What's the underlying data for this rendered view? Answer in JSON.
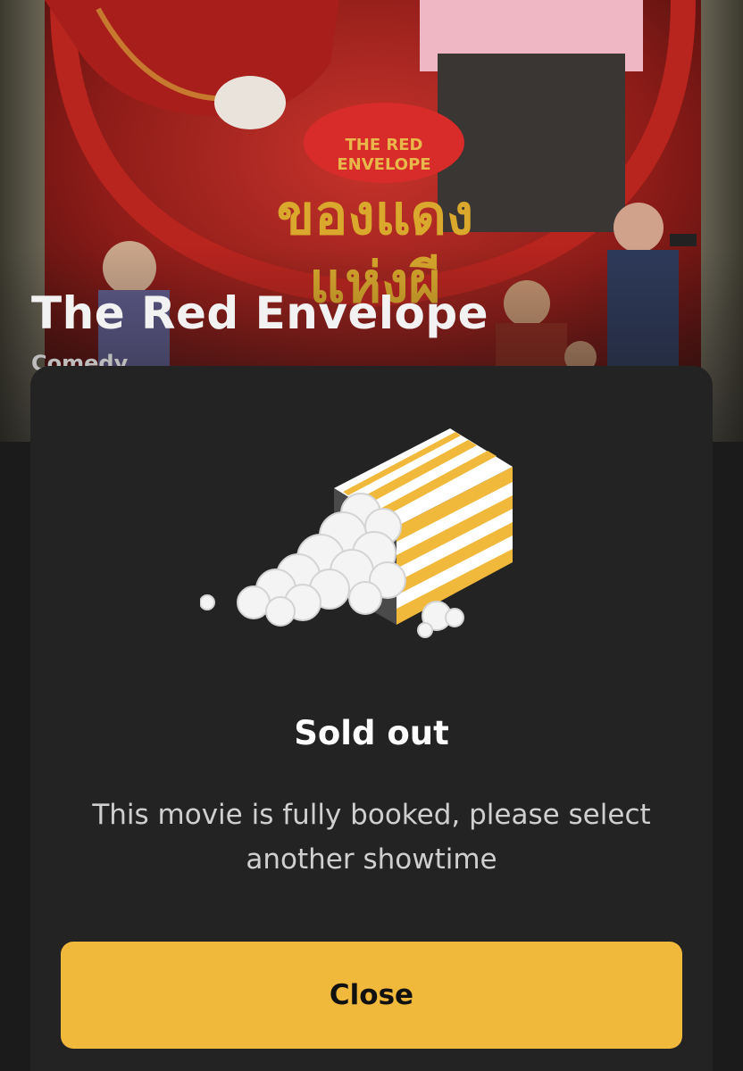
{
  "movie": {
    "title": "The Red Envelope",
    "genre": "Comedy",
    "poster": {
      "title_en": "THE RED ENVELOPE",
      "title_th": "ของแดง แห่งผี"
    }
  },
  "modal": {
    "illustration": "spilled-popcorn-box-icon",
    "title": "Sold out",
    "message": "This movie is fully booked, please select another showtime",
    "close_label": "Close"
  },
  "colors": {
    "accent": "#f0b93c",
    "modal_bg": "#232323",
    "page_bg": "#1b1b1b",
    "popcorn_stripe": "#f0b93c"
  }
}
